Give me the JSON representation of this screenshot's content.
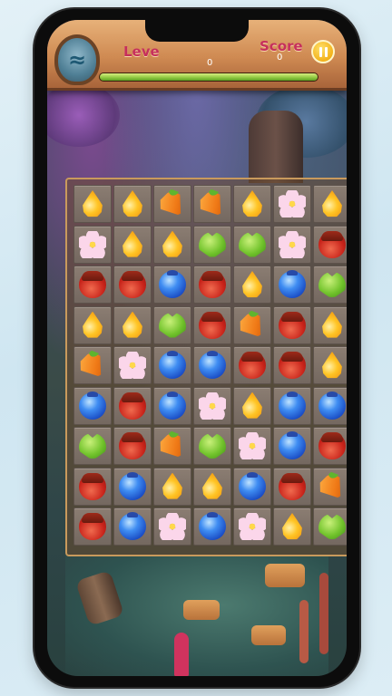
{
  "hud": {
    "level_label": "Leve",
    "level_value": "0",
    "score_label": "Score",
    "score_value": "0",
    "progress_fraction": 1.0,
    "emblem_icon": "aquarius-icon",
    "pause_icon": "pause-icon"
  },
  "board": {
    "rows": 9,
    "cols": 7,
    "cells": [
      [
        "drop",
        "drop",
        "carrot",
        "carrot",
        "drop",
        "flower",
        "drop"
      ],
      [
        "flower",
        "drop",
        "drop",
        "leaf",
        "leaf",
        "flower",
        "acorn"
      ],
      [
        "acorn",
        "acorn",
        "berry",
        "acorn",
        "drop",
        "berry",
        "leaf"
      ],
      [
        "drop",
        "drop",
        "leaf",
        "acorn",
        "carrot",
        "acorn",
        "drop"
      ],
      [
        "carrot",
        "flower",
        "berry",
        "berry",
        "acorn",
        "acorn",
        "drop"
      ],
      [
        "berry",
        "acorn",
        "berry",
        "flower",
        "drop",
        "berry",
        "berry"
      ],
      [
        "leaf",
        "acorn",
        "carrot",
        "leaf",
        "flower",
        "berry",
        "acorn"
      ],
      [
        "acorn",
        "berry",
        "drop",
        "drop",
        "berry",
        "acorn",
        "carrot"
      ],
      [
        "acorn",
        "berry",
        "flower",
        "berry",
        "flower",
        "drop",
        "leaf"
      ]
    ]
  },
  "colors": {
    "hud_wood": "#cf8a52",
    "label_pink": "#c62f5c",
    "progress_green": "#8cc63f",
    "pause_yellow": "#f3b21a",
    "tile": "#8b7d72"
  }
}
